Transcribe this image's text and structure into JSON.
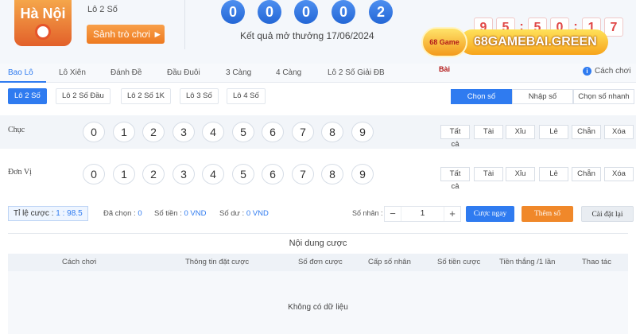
{
  "header": {
    "logo_text": "Hà Nội",
    "game_name": "Lô 2 Số",
    "play_button": "Sảnh trò chơi ►",
    "result_digits": [
      "0",
      "0",
      "0",
      "0",
      "2"
    ],
    "result_date": "Kết quả mở thưởng 17/06/2024",
    "timer_digits": [
      "9",
      "5",
      "5",
      "0",
      "1",
      "7"
    ],
    "timer_separators": [
      ":",
      ":"
    ],
    "brand_badge": "68 Game Bài",
    "brand_name": "68GAMEBAI.GREEN"
  },
  "tabs": [
    "Bao Lô",
    "Lô Xiên",
    "Đánh Đề",
    "Đầu Đuôi",
    "3 Càng",
    "4 Càng",
    "Lô 2 Số Giải ĐB"
  ],
  "active_tab": 0,
  "help_label": "Cách chơi",
  "subtabs": [
    "Lô 2 Số",
    "Lô 2 Số Đầu",
    "Lô 2 Số 1K",
    "Lô 3 Số",
    "Lô 4 Số"
  ],
  "active_subtab": 0,
  "modes": [
    "Chọn số",
    "Nhập số",
    "Chọn số nhanh"
  ],
  "active_mode": 0,
  "rows": [
    {
      "label": "Chục",
      "numbers": [
        "0",
        "1",
        "2",
        "3",
        "4",
        "5",
        "6",
        "7",
        "8",
        "9"
      ]
    },
    {
      "label": "Đơn Vị",
      "numbers": [
        "0",
        "1",
        "2",
        "3",
        "4",
        "5",
        "6",
        "7",
        "8",
        "9"
      ]
    }
  ],
  "quick_buttons": [
    "Tất cả",
    "Tài",
    "Xỉu",
    "Lẻ",
    "Chẵn",
    "Xóa"
  ],
  "status": {
    "odds_label": "Tỉ lệ cược :",
    "odds_value": "1 : 98.5",
    "selected_label": "Đã chọn :",
    "selected_value": "0",
    "amount_label": "Số tiền :",
    "amount_value": "0 VND",
    "balance_label": "Số dư :",
    "balance_value": "0 VND",
    "multiplier_label": "Số nhân :",
    "multiplier_value": "1",
    "minus": "−",
    "plus": "+"
  },
  "actions": {
    "bet_now": "Cược ngay",
    "add_number": "Thêm số",
    "reset": "Cài đặt lại"
  },
  "colors": {
    "accent": "#2f7bf0",
    "orange": "#f0882a",
    "timer_red": "#e04848"
  },
  "bet_table": {
    "title": "Nội dung cược",
    "columns": [
      "Cách chơi",
      "Thông tin đặt cược",
      "Số đơn cược",
      "Cấp số nhân",
      "Số tiền cược",
      "Tiền thắng /1 lần",
      "Thao tác"
    ],
    "empty_text": "Không có dữ liệu"
  }
}
